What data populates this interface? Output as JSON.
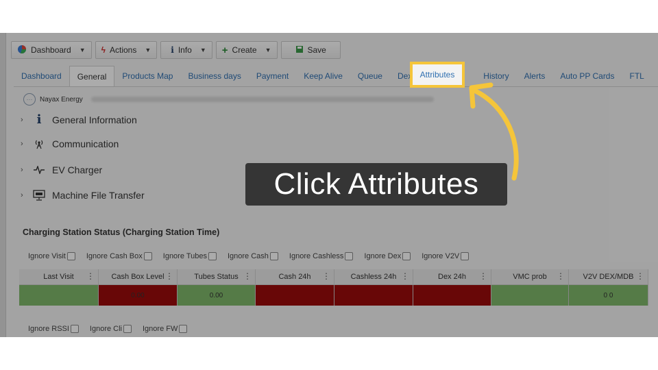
{
  "toolbar": {
    "dashboard_label": "Dashboard",
    "actions_label": "Actions",
    "info_label": "Info",
    "create_label": "Create",
    "save_label": "Save"
  },
  "tabs": [
    {
      "label": "Dashboard"
    },
    {
      "label": "General"
    },
    {
      "label": "Products Map"
    },
    {
      "label": "Business days"
    },
    {
      "label": "Payment"
    },
    {
      "label": "Keep Alive"
    },
    {
      "label": "Queue"
    },
    {
      "label": "Dex"
    },
    {
      "label": "Attributes"
    },
    {
      "label": "History"
    },
    {
      "label": "Alerts"
    },
    {
      "label": "Auto PP Cards"
    },
    {
      "label": "FTL"
    }
  ],
  "machine": {
    "name": "Nayax Energy"
  },
  "sections": [
    {
      "label": "General Information"
    },
    {
      "label": "Communication"
    },
    {
      "label": "EV Charger"
    },
    {
      "label": "Machine File Transfer"
    }
  ],
  "status": {
    "title": "Charging Station Status (Charging Station Time)",
    "ignores_row1": [
      "Ignore Visit",
      "Ignore Cash Box",
      "Ignore Tubes",
      "Ignore Cash",
      "Ignore Cashless",
      "Ignore Dex",
      "Ignore V2V"
    ],
    "ignores_row2": [
      "Ignore RSSI",
      "Ignore Cli",
      "Ignore FW"
    ],
    "columns": [
      "Last Visit",
      "Cash Box Level",
      "Tubes Status",
      "Cash 24h",
      "Cashless 24h",
      "Dex 24h",
      "VMC prob",
      "V2V DEX/MDB"
    ],
    "row": [
      "",
      "0.00",
      "0.00",
      "",
      "",
      "",
      "",
      "0 0"
    ],
    "cell_colors": [
      "#7fb86a",
      "#9b0b0b",
      "#7fb86a",
      "#9b0b0b",
      "#9b0b0b",
      "#9b0b0b",
      "#7fb86a",
      "#7fb86a"
    ]
  },
  "callout": {
    "text": "Click Attributes"
  },
  "colors": {
    "highlight": "#f5c53a",
    "link": "#2f6fb0"
  }
}
